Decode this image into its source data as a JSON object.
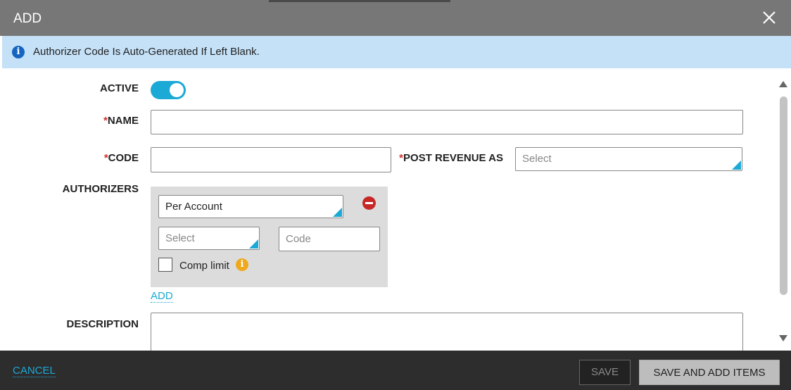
{
  "dialog": {
    "title": "ADD",
    "close_icon": "close-icon"
  },
  "info": {
    "icon": "info-icon",
    "text": "Authorizer Code Is Auto-Generated If Left Blank."
  },
  "form": {
    "active": {
      "label": "ACTIVE",
      "value": true
    },
    "name": {
      "required_mark": "*",
      "label": "NAME",
      "value": ""
    },
    "code": {
      "required_mark": "*",
      "label": "CODE",
      "value": ""
    },
    "post_revenue": {
      "required_mark": "*",
      "label": "POST REVENUE AS",
      "placeholder": "Select"
    },
    "authorizers": {
      "label": "AUTHORIZERS",
      "type_value": "Per Account",
      "account_placeholder": "Select",
      "code_placeholder": "Code",
      "comp_limit_label": "Comp limit",
      "comp_limit_checked": false,
      "remove_icon": "minus-circle-icon",
      "info_icon": "info-icon"
    },
    "add_link": "ADD",
    "description": {
      "label": "DESCRIPTION",
      "value": ""
    }
  },
  "footer": {
    "cancel": "CANCEL",
    "save": "SAVE",
    "save_and_add": "SAVE AND ADD ITEMS"
  },
  "colors": {
    "accent": "#1ba9d6",
    "titlebar": "#777777",
    "infobar": "#c5e1f7",
    "required": "#d32f2f",
    "footer": "#2d2d2d"
  }
}
